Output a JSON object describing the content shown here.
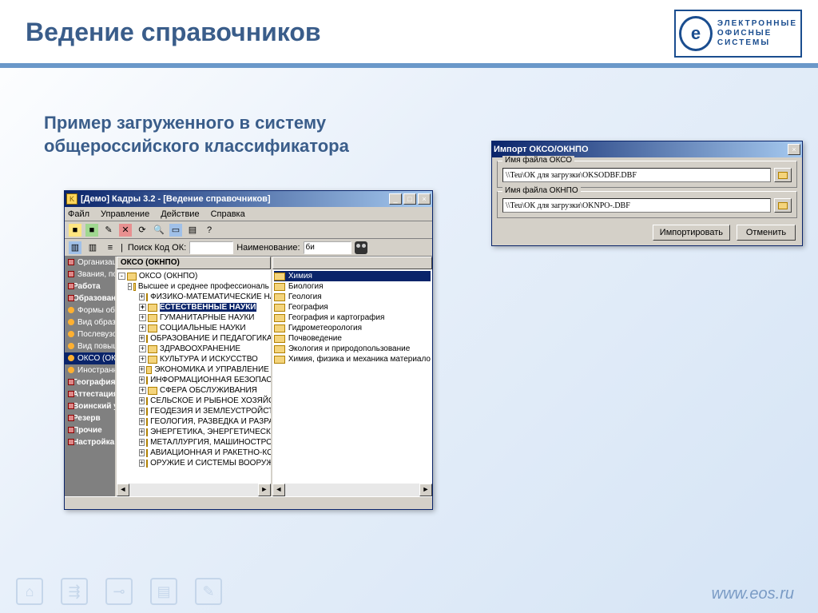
{
  "slide": {
    "title": "Ведение справочников",
    "subtitle": "Пример загруженного в систему общероссийского классификатора",
    "footer_url": "www.eos.ru",
    "logo_line1": "ЭЛЕКТРОННЫЕ",
    "logo_line2": "ОФИСНЫЕ",
    "logo_line3": "СИСТЕМЫ"
  },
  "mainwin": {
    "title": "[Демо] Кадры 3.2 - [Ведение справочников]",
    "menu": [
      "Файл",
      "Управление",
      "Действие",
      "Справка"
    ],
    "search_label1": "Поиск Код ОК:",
    "search_label2": "Наименование:",
    "search_value": "би",
    "mid_header": "ОКСО (ОКНПО)",
    "right_header": "",
    "nav": [
      {
        "label": "Организации, должности",
        "kind": "bk",
        "bold": false
      },
      {
        "label": "Звания, поощрения, взыска",
        "kind": "bk",
        "bold": false
      },
      {
        "label": "Работа",
        "kind": "bk",
        "bold": true
      },
      {
        "label": "Образование, обучение",
        "kind": "bk",
        "bold": true
      },
      {
        "label": "Формы обучения",
        "kind": "dot",
        "bold": false
      },
      {
        "label": "Вид образования",
        "kind": "dot",
        "bold": false
      },
      {
        "label": "Послевузовское образо",
        "kind": "dot",
        "bold": false
      },
      {
        "label": "Вид повышения квалифи",
        "kind": "dot",
        "bold": false
      },
      {
        "label": "ОКСО (ОКНПО)",
        "kind": "dot",
        "bold": false,
        "sel": true
      },
      {
        "label": "Иностранные языки",
        "kind": "dot",
        "bold": false
      },
      {
        "label": "География, командировки",
        "kind": "bk",
        "bold": true
      },
      {
        "label": "Аттестация",
        "kind": "bk",
        "bold": true
      },
      {
        "label": "Воинский учет",
        "kind": "bk",
        "bold": true
      },
      {
        "label": "Резерв",
        "kind": "bk",
        "bold": true
      },
      {
        "label": "Прочие",
        "kind": "bk",
        "bold": true
      },
      {
        "label": "Настройка системы",
        "kind": "bk",
        "bold": true
      }
    ],
    "tree_root": "ОКСО (ОКНПО)",
    "tree_l2": "Высшее и среднее профессиональ",
    "tree_items": [
      "ФИЗИКО-МАТЕМАТИЧЕСКИЕ НАУ",
      "ЕСТЕСТВЕННЫЕ НАУКИ",
      "ГУМАНИТАРНЫЕ НАУКИ",
      "СОЦИАЛЬНЫЕ НАУКИ",
      "ОБРАЗОВАНИЕ И ПЕДАГОГИКА",
      "ЗДРАВООХРАНЕНИЕ",
      "КУЛЬТУРА И ИСКУССТВО",
      "ЭКОНОМИКА И УПРАВЛЕНИЕ",
      "ИНФОРМАЦИОННАЯ БЕЗОПАСН",
      "СФЕРА ОБСЛУЖИВАНИЯ",
      "СЕЛЬСКОЕ И РЫБНОЕ ХОЗЯЙСТ",
      "ГЕОДЕЗИЯ И ЗЕМЛЕУСТРОЙСТВ",
      "ГЕОЛОГИЯ, РАЗВЕДКА И РАЗРА",
      "ЭНЕРГЕТИКА, ЭНЕРГЕТИЧЕСКО",
      "МЕТАЛЛУРГИЯ, МАШИНОСТРОЕ",
      "АВИАЦИОННАЯ И РАКЕТНО-КОС",
      "ОРУЖИЕ И СИСТЕМЫ ВООРУЖЕ"
    ],
    "tree_selected_index": 1,
    "list": [
      "Химия",
      "Биология",
      "Геология",
      "География",
      "География и картография",
      "Гидрометеорология",
      "Почвоведение",
      "Экология и природопользование",
      "Химия, физика и механика материало"
    ],
    "list_selected_index": 0
  },
  "dialog": {
    "title": "Импорт ОКСО/ОКНПО",
    "group1_label": "Имя файла ОКСО",
    "group1_value": "\\\\Teu\\ОК для загрузки\\OKSODBF.DBF",
    "group2_label": "Имя файла ОКНПО",
    "group2_value": "\\\\Teu\\ОК для загрузки\\OKNPO-.DBF",
    "btn_import": "Импортировать",
    "btn_cancel": "Отменить"
  }
}
